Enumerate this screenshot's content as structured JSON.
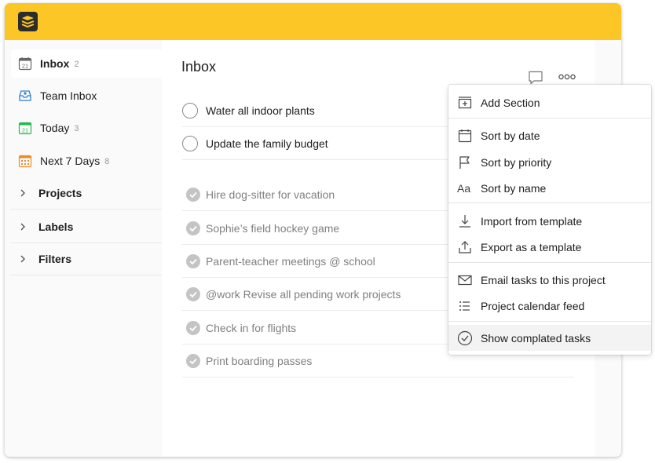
{
  "app": {
    "brand_color": "#fcc726",
    "logo_icon": "todoist-logo-icon"
  },
  "sidebar": {
    "items": [
      {
        "label": "Inbox",
        "count": "2",
        "icon": "inbox-icon",
        "active": true
      },
      {
        "label": "Team Inbox",
        "count": "",
        "icon": "team-inbox-icon"
      },
      {
        "label": "Today",
        "count": "3",
        "icon": "today-calendar-icon",
        "day": "21"
      },
      {
        "label": "Next 7 Days",
        "count": "8",
        "icon": "next-7-days-icon"
      }
    ],
    "groups": [
      {
        "label": "Projects"
      },
      {
        "label": "Labels"
      },
      {
        "label": "Filters"
      }
    ],
    "inbox_day": "21"
  },
  "main": {
    "title": "Inbox",
    "tasks": [
      {
        "text": "Water all indoor plants",
        "completed": false
      },
      {
        "text": "Update the family budget",
        "completed": false
      },
      {
        "text": "Hire dog-sitter for vacation",
        "completed": true
      },
      {
        "text": "Sophie’s field hockey game",
        "completed": true
      },
      {
        "text": "Parent-teacher meetings @ school",
        "completed": true
      },
      {
        "text": "@work Revise all pending work projects",
        "completed": true
      },
      {
        "text": "Check in for flights",
        "completed": true
      },
      {
        "text": "Print boarding passes",
        "completed": true
      }
    ]
  },
  "menu": {
    "items": [
      {
        "label": "Add Section",
        "icon": "add-section-icon"
      },
      {
        "label": "Sort by date",
        "icon": "calendar-icon"
      },
      {
        "label": "Sort by priority",
        "icon": "flag-icon"
      },
      {
        "label": "Sort by name",
        "icon": "text-aa-icon",
        "glyph": "Aa"
      },
      {
        "label": "Import from template",
        "icon": "download-icon"
      },
      {
        "label": "Export as a template",
        "icon": "upload-icon"
      },
      {
        "label": "Email tasks to this project",
        "icon": "mail-icon"
      },
      {
        "label": "Project calendar feed",
        "icon": "list-icon"
      },
      {
        "label": "Show complated tasks",
        "icon": "check-circle-icon"
      }
    ]
  }
}
